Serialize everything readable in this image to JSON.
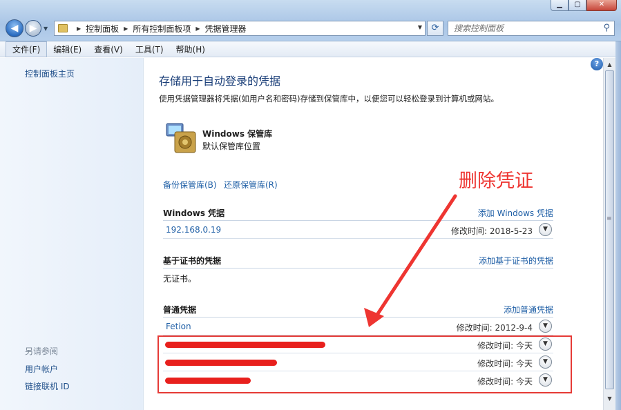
{
  "window": {
    "min_icon": "minimize-icon",
    "max_icon": "maximize-icon",
    "close_icon": "close-icon"
  },
  "address": {
    "crumbs": [
      "控制面板",
      "所有控制面板项",
      "凭据管理器"
    ]
  },
  "search": {
    "placeholder": "搜索控制面板"
  },
  "menu": [
    "文件(F)",
    "编辑(E)",
    "查看(V)",
    "工具(T)",
    "帮助(H)"
  ],
  "sidebar": {
    "home": "控制面板主页",
    "see_also": "另请参阅",
    "links": [
      "用户帐户",
      "链接联机 ID"
    ]
  },
  "main": {
    "title": "存储用于自动登录的凭据",
    "description": "使用凭据管理器将凭据(如用户名和密码)存储到保管库中，以便您可以轻松登录到计算机或网站。",
    "vault_name": "Windows 保管库",
    "vault_sub": "默认保管库位置",
    "backup": "备份保管库(B)",
    "restore": "还原保管库(R)",
    "windows_section": {
      "heading": "Windows 凭据",
      "add": "添加 Windows 凭据",
      "rows": [
        {
          "name": "192.168.0.19",
          "modified": "修改时间:  2018-5-23"
        }
      ]
    },
    "cert_section": {
      "heading": "基于证书的凭据",
      "add": "添加基于证书的凭据",
      "empty": "无证书。"
    },
    "generic_section": {
      "heading": "普通凭据",
      "add": "添加普通凭据",
      "rows": [
        {
          "name": "Fetion",
          "modified": "修改时间:  2012-9-4"
        },
        {
          "name": "",
          "modified": "修改时间:  今天"
        },
        {
          "name": "",
          "modified": "修改时间:  今天"
        },
        {
          "name": "",
          "modified": "修改时间:  今天"
        }
      ]
    },
    "annotation": "删除凭证"
  },
  "colors": {
    "annotation_red": "#ee3531",
    "link_blue": "#1f5fa6",
    "title_blue": "#1a3e78"
  }
}
